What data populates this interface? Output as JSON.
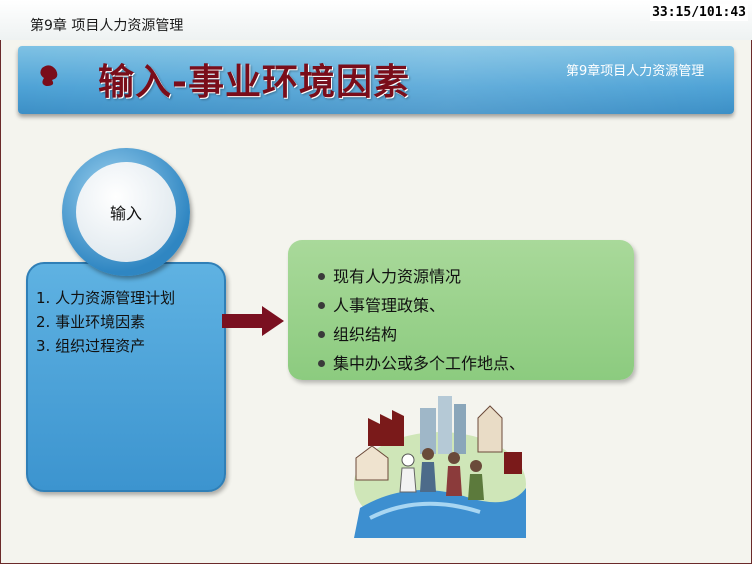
{
  "header": {
    "chapter": "第9章 项目人力资源管理",
    "timer": "33:15/101:43"
  },
  "slide": {
    "title": "输入-事业环境因素",
    "chapter_label": "第9章项目人力资源管理"
  },
  "input_panel": {
    "circle_label": "输入",
    "items": [
      "1. 人力资源管理计划",
      "2. 事业环境因素",
      "3. 组织过程资产"
    ]
  },
  "factors": {
    "items": [
      "现有人力资源情况",
      "人事管理政策、",
      "组织结构",
      "集中办公或多个工作地点、"
    ]
  },
  "colors": {
    "title": "#7a0d1a",
    "banner": "#4fa3d6",
    "blue_box": "#3c94cf",
    "green_box": "#8ccb7f",
    "arrow": "#7a1020"
  }
}
